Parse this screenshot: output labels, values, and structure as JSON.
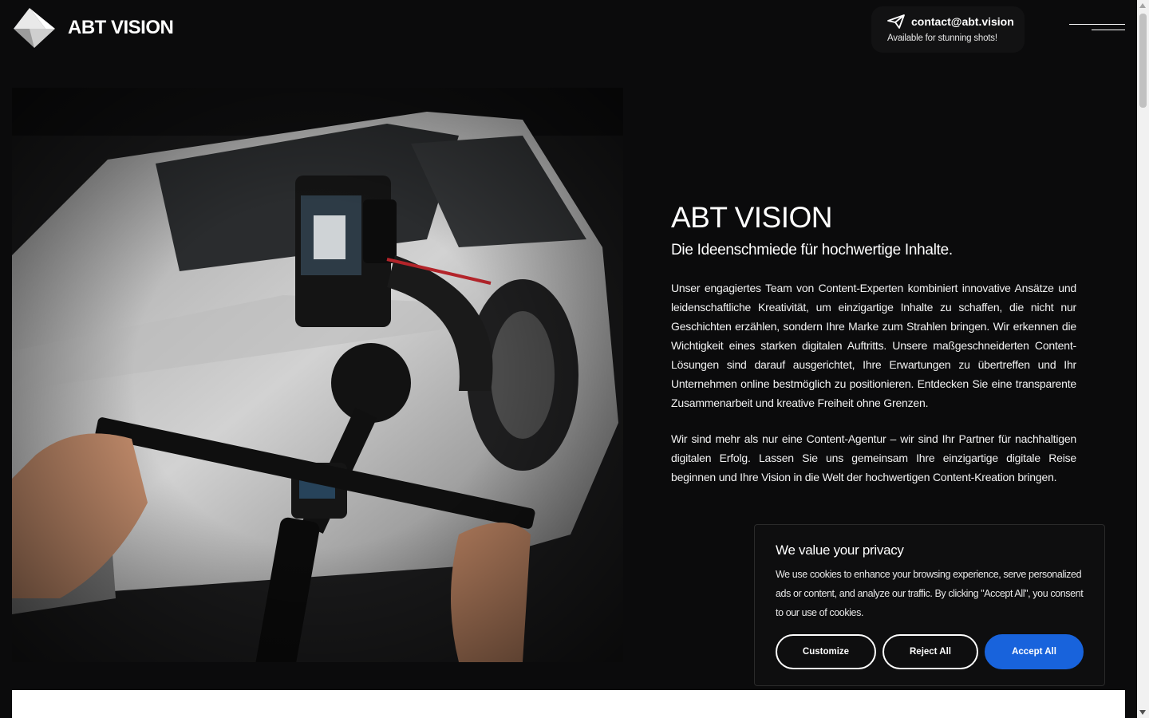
{
  "header": {
    "logo_text": "ABT VISION",
    "contact_email": "contact@abt.vision",
    "contact_subtitle": "Available for stunning shots!",
    "contact_icon": "paper-plane-icon",
    "menu_icon": "hamburger-icon"
  },
  "hero": {
    "title": "ABT VISION",
    "subtitle": "Die Ideenschmiede für hochwertige Inhalte.",
    "paragraphs": [
      "Unser engagiertes Team von Content-Experten kombiniert innovative Ansätze und leidenschaftliche Kreativität, um einzigartige Inhalte zu schaffen, die nicht nur Geschichten erzählen, sondern Ihre Marke zum Strahlen bringen. Wir erkennen die Wichtigkeit eines starken digitalen Auftritts. Unsere maßgeschneiderten Content-Lösungen sind darauf ausgerichtet, Ihre Erwartungen zu übertreffen und Ihr Unternehmen online bestmöglich zu positionieren. Entdecken Sie eine transparente Zusammenarbeit und kreative Freiheit ohne Grenzen.",
      "Wir sind mehr als nur eine Content-Agentur – wir sind Ihr Partner für nachhaltigen digitalen Erfolg. Lassen Sie uns gemeinsam Ihre einzigartige digitale Reise beginnen und Ihre Vision in die Welt der hochwertigen Content-Kreation bringen."
    ]
  },
  "cookie_banner": {
    "title": "We value your privacy",
    "description": "We use cookies to enhance your browsing experience, serve personalized ads or content, and analyze our traffic. By clicking \"Accept All\", you consent to our use of cookies.",
    "customize_label": "Customize",
    "reject_label": "Reject All",
    "accept_label": "Accept All",
    "accept_color": "#1863dc"
  },
  "colors": {
    "background": "#0b0b0c",
    "text": "#ffffff",
    "accent": "#1863dc"
  }
}
